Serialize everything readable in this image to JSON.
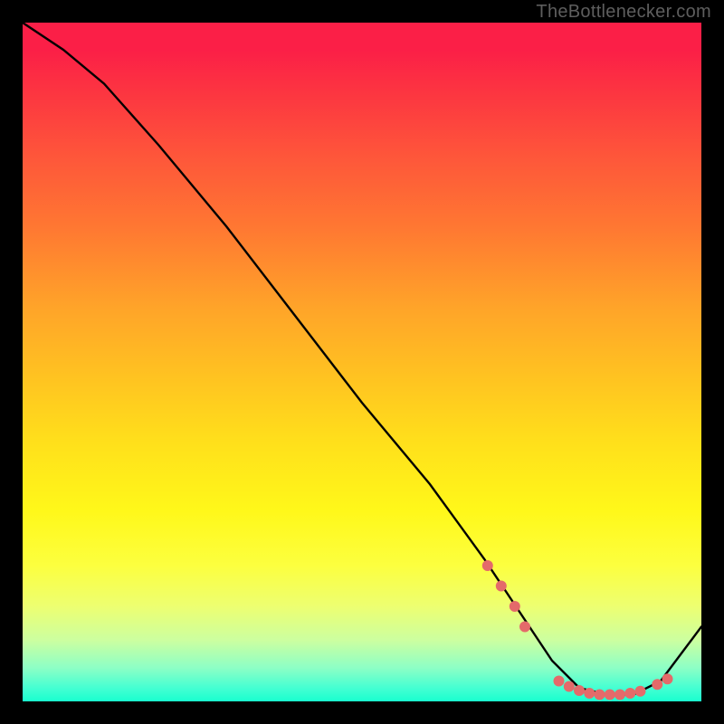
{
  "attribution": "TheBottlenecker.com",
  "chart_data": {
    "type": "line",
    "title": "",
    "xlabel": "",
    "ylabel": "",
    "xlim": [
      0,
      100
    ],
    "ylim": [
      0,
      100
    ],
    "series": [
      {
        "name": "bottleneck-curve",
        "color": "#000000",
        "x": [
          0,
          6,
          12,
          20,
          30,
          40,
          50,
          60,
          68,
          74,
          78,
          82,
          86,
          90,
          94,
          100
        ],
        "y": [
          100,
          96,
          91,
          82,
          70,
          57,
          44,
          32,
          21,
          12,
          6,
          2,
          1,
          1,
          3,
          11
        ]
      },
      {
        "name": "highlight-dots",
        "color": "#e46a6a",
        "x": [
          68.5,
          70.5,
          72.5,
          74,
          79,
          80.5,
          82,
          83.5,
          85,
          86.5,
          88,
          89.5,
          91,
          93.5,
          95
        ],
        "y": [
          20,
          17,
          14,
          11,
          3.0,
          2.2,
          1.6,
          1.2,
          1.0,
          1.0,
          1.0,
          1.2,
          1.5,
          2.5,
          3.3
        ]
      }
    ]
  }
}
